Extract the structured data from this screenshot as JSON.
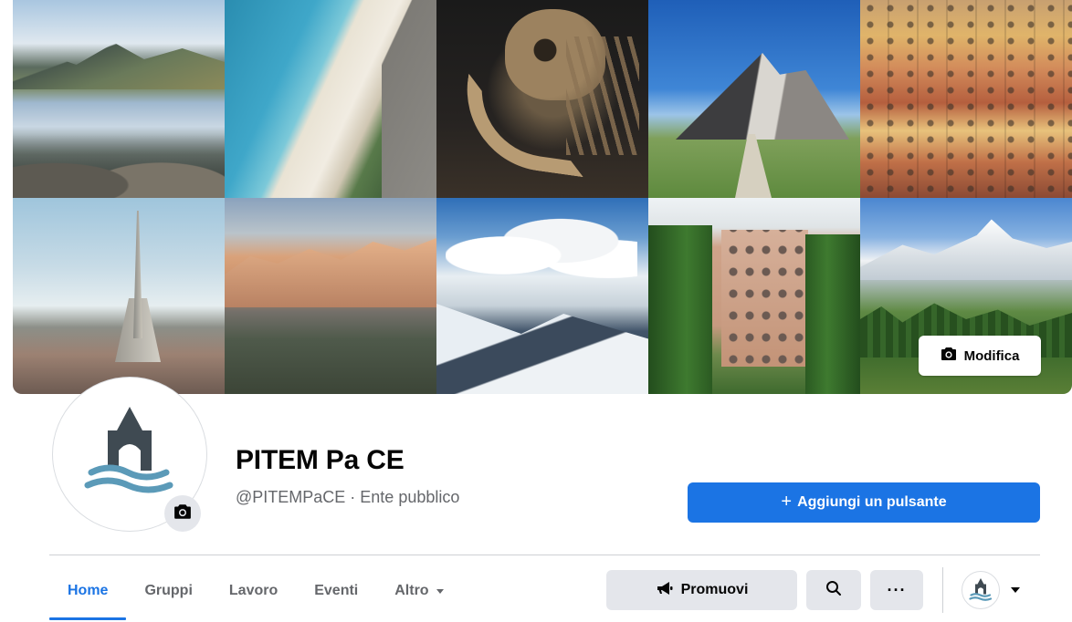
{
  "cover": {
    "tiles": [
      {
        "name": "mountain-lake-photo"
      },
      {
        "name": "coastline-beach-photo"
      },
      {
        "name": "mammoth-skeleton-photo"
      },
      {
        "name": "rocky-peak-trail-photo"
      },
      {
        "name": "colorful-houses-photo"
      },
      {
        "name": "mole-antonelliana-photo"
      },
      {
        "name": "sunlit-cliff-photo"
      },
      {
        "name": "snowy-mountains-clouds-photo"
      },
      {
        "name": "palace-garden-photo"
      },
      {
        "name": "alpine-valley-photo"
      }
    ],
    "edit_label": "Modifica"
  },
  "profile": {
    "name": "PITEM Pa CE",
    "subtitle": "@PITEMPaCE · Ente pubblico"
  },
  "cta": {
    "add_button_label": "Aggiungi un pulsante"
  },
  "tabs": [
    {
      "label": "Home",
      "active": true
    },
    {
      "label": "Gruppi",
      "active": false
    },
    {
      "label": "Lavoro",
      "active": false
    },
    {
      "label": "Eventi",
      "active": false
    },
    {
      "label": "Altro",
      "active": false,
      "has_dropdown": true
    }
  ],
  "actions": {
    "promote_label": "Promuovi",
    "more_label": "···"
  },
  "colors": {
    "accent": "#1b74e4",
    "secondary_button": "#e4e6eb",
    "muted_text": "#65676b",
    "logo_dark": "#3f4a52",
    "logo_water": "#5b9ab8"
  },
  "icons": [
    "camera-icon",
    "megaphone-icon",
    "search-icon",
    "more-icon",
    "chevron-down-icon",
    "plus-icon"
  ]
}
